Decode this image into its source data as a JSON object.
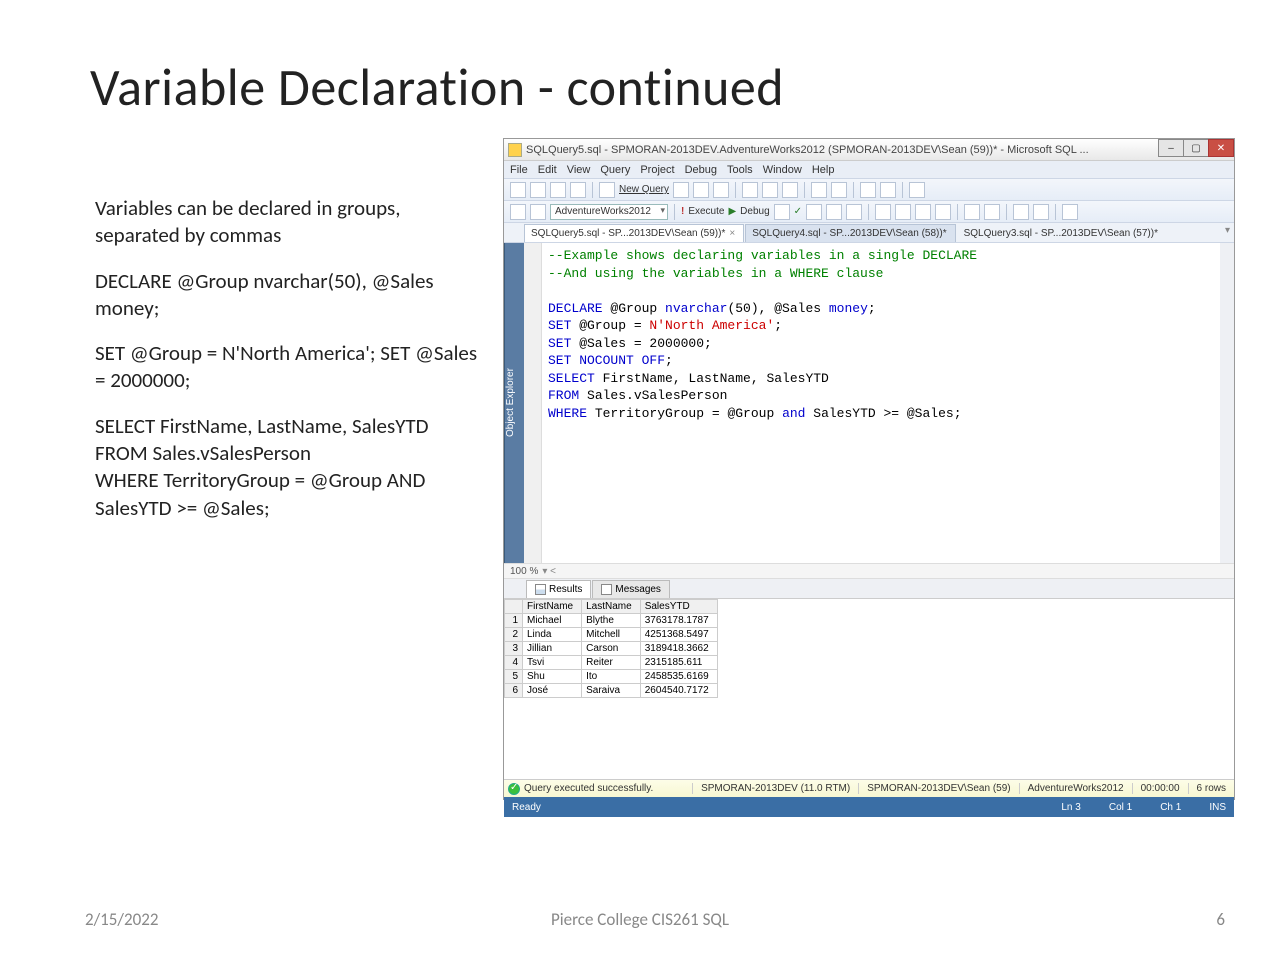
{
  "slide": {
    "title": "Variable Declaration - continued",
    "bullets": {
      "b1": "Variables can be declared in groups, separated by commas",
      "b2": "DECLARE @Group nvarchar(50), @Sales money;",
      "b3": "SET @Group = N'North America'; SET @Sales = 2000000;",
      "b4": "SELECT FirstName, LastName, SalesYTD\nFROM Sales.vSalesPerson\nWHERE TerritoryGroup = @Group AND SalesYTD >= @Sales;"
    },
    "footer_date": "2/15/2022",
    "footer_center": "Pierce College CIS261 SQL",
    "footer_page": "6"
  },
  "ssms": {
    "window_title": "SQLQuery5.sql - SPMORAN-2013DEV.AdventureWorks2012 (SPMORAN-2013DEV\\Sean (59))* - Microsoft SQL ...",
    "menu": [
      "File",
      "Edit",
      "View",
      "Query",
      "Project",
      "Debug",
      "Tools",
      "Window",
      "Help"
    ],
    "toolbar": {
      "new_query": "New Query",
      "db": "AdventureWorks2012",
      "execute": "Execute",
      "debug": "Debug"
    },
    "tabs": {
      "t1": "SQLQuery5.sql - SP...2013DEV\\Sean (59))*",
      "t2": "SQLQuery4.sql - SP...2013DEV\\Sean (58))*",
      "t3": "SQLQuery3.sql - SP...2013DEV\\Sean (57))*"
    },
    "side": "Object Explorer",
    "code": {
      "c1a": "--Example shows declaring variables in a single DECLARE",
      "c1b": "--And using the variables in a WHERE clause",
      "c2": "DECLARE",
      "c2b": " @Group ",
      "c2c": "nvarchar",
      "c2d": "(50), @Sales ",
      "c2e": "money",
      "c2f": ";",
      "c3": "SET",
      "c3b": " @Group = ",
      "c3c": "N'North America'",
      "c3d": ";",
      "c4": "SET",
      "c4b": " @Sales = 2000000;",
      "c5": "SET NOCOUNT OFF",
      "c5b": ";",
      "c6": "SELECT",
      "c6b": " FirstName, LastName, SalesYTD",
      "c7": "FROM",
      "c7b": " Sales.vSalesPerson",
      "c8": "WHERE",
      "c8b": " TerritoryGroup = @Group ",
      "c8c": "and",
      "c8d": " SalesYTD >= @Sales;"
    },
    "zoom": "100 %",
    "result_tabs": {
      "results": "Results",
      "messages": "Messages"
    },
    "columns": [
      "FirstName",
      "LastName",
      "SalesYTD"
    ],
    "rows": [
      {
        "n": "1",
        "FirstName": "Michael",
        "LastName": "Blythe",
        "SalesYTD": "3763178.1787"
      },
      {
        "n": "2",
        "FirstName": "Linda",
        "LastName": "Mitchell",
        "SalesYTD": "4251368.5497"
      },
      {
        "n": "3",
        "FirstName": "Jillian",
        "LastName": "Carson",
        "SalesYTD": "3189418.3662"
      },
      {
        "n": "4",
        "FirstName": "Tsvi",
        "LastName": "Reiter",
        "SalesYTD": "2315185.611"
      },
      {
        "n": "5",
        "FirstName": "Shu",
        "LastName": "Ito",
        "SalesYTD": "2458535.6169"
      },
      {
        "n": "6",
        "FirstName": "José",
        "LastName": "Saraiva",
        "SalesYTD": "2604540.7172"
      }
    ],
    "status": {
      "msg": "Query executed successfully.",
      "server": "SPMORAN-2013DEV (11.0 RTM)",
      "user": "SPMORAN-2013DEV\\Sean (59)",
      "db": "AdventureWorks2012",
      "time": "00:00:00",
      "rows": "6 rows"
    },
    "statusbar": {
      "ready": "Ready",
      "ln": "Ln 3",
      "col": "Col 1",
      "ch": "Ch 1",
      "ins": "INS"
    }
  }
}
